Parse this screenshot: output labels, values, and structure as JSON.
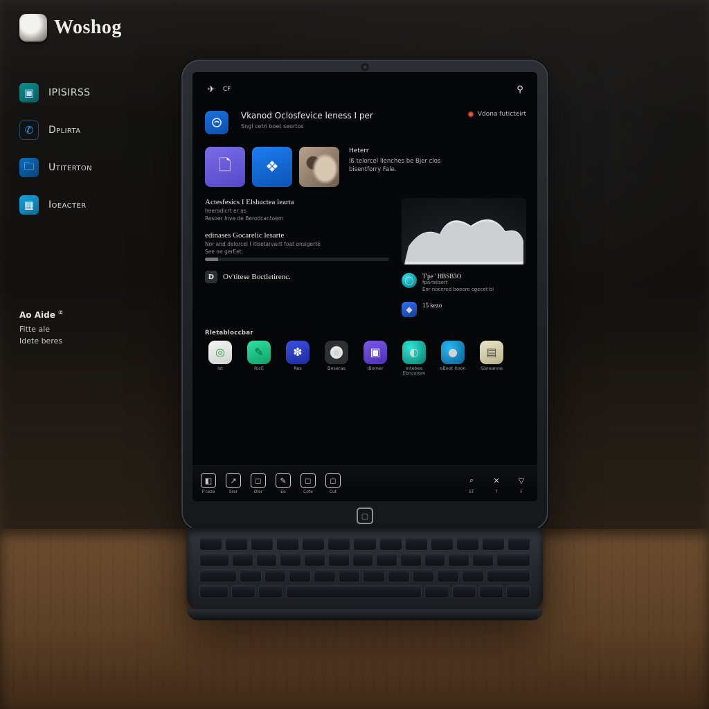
{
  "brand": {
    "name": "Woshog"
  },
  "sidebar": {
    "items": [
      {
        "label": "IPISIRSS"
      },
      {
        "label": "Dplirta"
      },
      {
        "label": "Utiterton"
      },
      {
        "label": "Ioeacter"
      }
    ]
  },
  "sidenote": {
    "title": "Ao  Aide",
    "line1": "Fitte ale",
    "line2": "Idete beres",
    "badge": "②"
  },
  "screen": {
    "topbar": {
      "left_label": "CF",
      "right_label": "S"
    },
    "feature": {
      "title": "Vkanod Oclosfevice leness I per",
      "subtitle": "Sngl cetri boet seortos",
      "side_label": "Vdona futicteirt"
    },
    "tiles_note": {
      "heading": "Heterr",
      "body": "Iß telorcel  lienches be Bjer clos bisentforry Fale."
    },
    "sections": [
      {
        "title": "Actesfesics I Elsbactea learta",
        "line1": "heeradicrt er as",
        "line2": "Resoer  Inve de Berodcantoem"
      },
      {
        "title": "edinases Gocarelic lesarte",
        "line1": "Nor and delorcel I itisetarvant foat onsigerté",
        "line2": "See oe gerEet."
      },
      {
        "title": "Ov'titese  Boctletirenc.",
        "line1": "",
        "chip": "D"
      }
    ],
    "right": {
      "panelA": {
        "title": "T'pe ' HBSB3O",
        "sub": "fpartelsert",
        "body": "Eor nocered boeore cgecet bi"
      },
      "panelB": {
        "title": "15 kezo"
      }
    },
    "apps": {
      "heading": "Rletabloccbar",
      "items": [
        {
          "label": "Ist",
          "glyph": "◎"
        },
        {
          "label": "RicE",
          "glyph": "✎"
        },
        {
          "label": "Res",
          "glyph": "✽"
        },
        {
          "label": "Beseras",
          "glyph": "◉"
        },
        {
          "label": "IBomer",
          "glyph": "▣"
        },
        {
          "label": "Intebes Ebncorom",
          "glyph": "◐"
        },
        {
          "label": "oBoot Itoon",
          "glyph": "●"
        },
        {
          "label": "Sisreanne",
          "glyph": "▤"
        }
      ]
    },
    "taskbar": {
      "items": [
        {
          "label": "F'ceze",
          "glyph": "◧"
        },
        {
          "label": "Srer",
          "glyph": "↗"
        },
        {
          "label": "Oler",
          "glyph": "◻"
        },
        {
          "label": "Eo",
          "glyph": "✎"
        },
        {
          "label": "Cote",
          "glyph": "◻"
        },
        {
          "label": "Cut",
          "glyph": "◻"
        },
        {
          "label": "ST",
          "glyph": "⌕"
        },
        {
          "label": "7",
          "glyph": "✕"
        },
        {
          "label": "F",
          "glyph": "▽"
        }
      ]
    }
  },
  "colors": {
    "accent_blue": "#1d7df0",
    "accent_purple": "#6a58dc",
    "teal": "#1fd3c4"
  }
}
